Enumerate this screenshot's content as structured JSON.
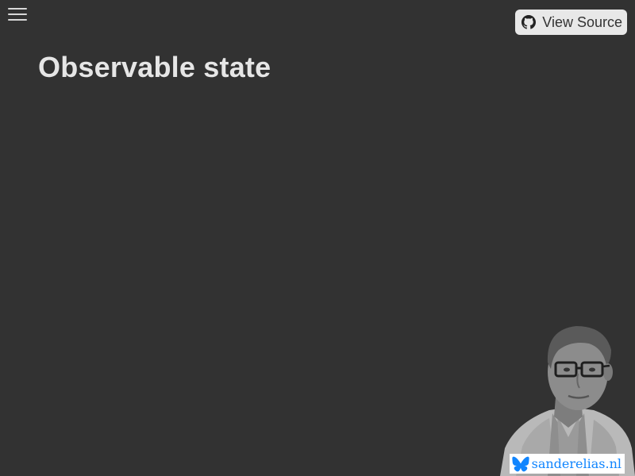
{
  "header": {
    "menu_label": "",
    "view_source_label": "View Source",
    "view_source_icon": "github-icon"
  },
  "main": {
    "title": "Observable state"
  },
  "author": {
    "portrait_icon": "author-portrait",
    "site_label": "sanderelias.nl",
    "site_icon": "bluesky-butterfly-icon"
  },
  "colors": {
    "background": "#323232",
    "title": "#e6e6e6",
    "button_bg": "#e8e8e8",
    "link_blue": "#1185fe"
  }
}
